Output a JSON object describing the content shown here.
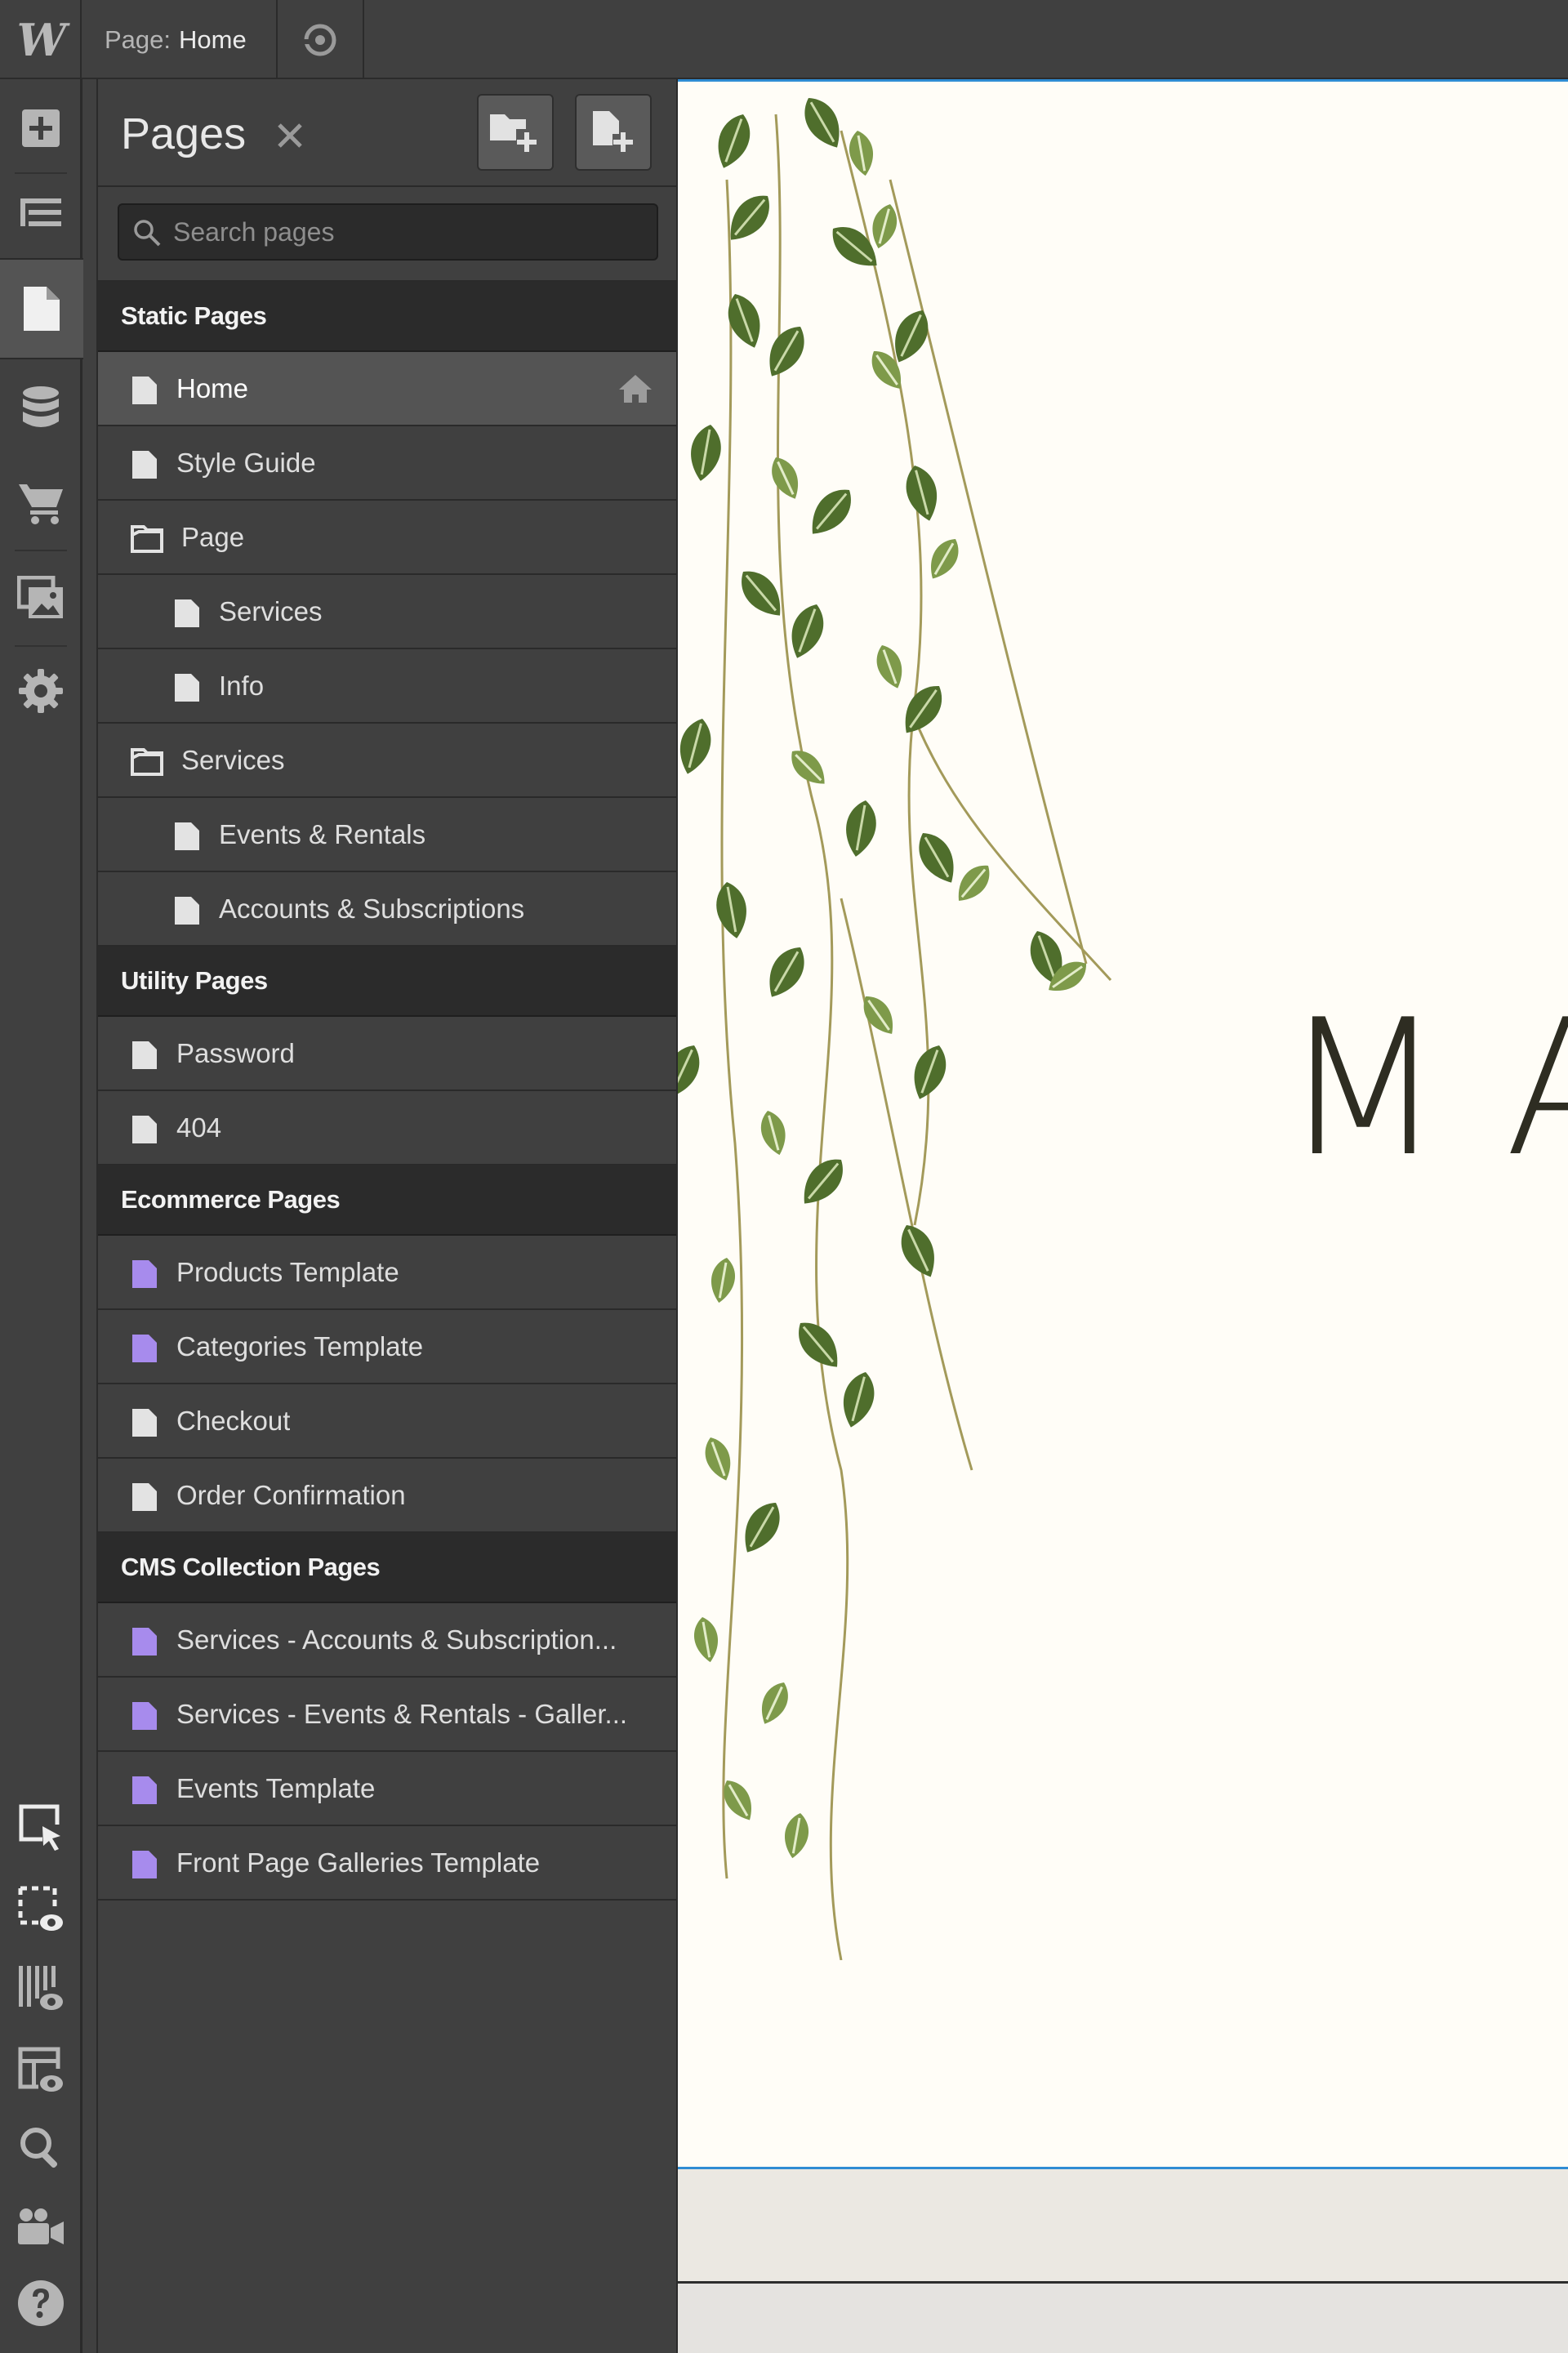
{
  "app": {
    "logo": "W"
  },
  "topbar": {
    "page_label": "Page:",
    "page_name": "Home"
  },
  "rail": {
    "items": [
      "add-icon",
      "navigator-icon",
      "pages-icon",
      "cms-icon",
      "ecommerce-icon",
      "assets-icon",
      "settings-icon"
    ],
    "bottom_items": [
      "select-element-icon",
      "show-outlines-icon",
      "grid-overlay-icon",
      "layout-preview-icon",
      "search-icon",
      "video-tutorials-icon",
      "help-icon"
    ],
    "active": "pages-icon"
  },
  "panel": {
    "title": "Pages",
    "search_placeholder": "Search pages",
    "sections": [
      {
        "title": "Static Pages",
        "rows": [
          {
            "label": "Home",
            "icon": "page",
            "level": 0,
            "selected": true,
            "home": true
          },
          {
            "label": "Style Guide",
            "icon": "page",
            "level": 0
          },
          {
            "label": "Page",
            "icon": "folder",
            "level": 0
          },
          {
            "label": "Services",
            "icon": "page",
            "level": 1
          },
          {
            "label": "Info",
            "icon": "page",
            "level": 1
          },
          {
            "label": "Services",
            "icon": "folder",
            "level": 0
          },
          {
            "label": "Events & Rentals",
            "icon": "page",
            "level": 1
          },
          {
            "label": "Accounts & Subscriptions",
            "icon": "page",
            "level": 1
          }
        ]
      },
      {
        "title": "Utility Pages",
        "rows": [
          {
            "label": "Password",
            "icon": "page",
            "level": 0
          },
          {
            "label": "404",
            "icon": "page",
            "level": 0
          }
        ]
      },
      {
        "title": "Ecommerce Pages",
        "rows": [
          {
            "label": "Products Template",
            "icon": "template",
            "level": 0
          },
          {
            "label": "Categories Template",
            "icon": "template",
            "level": 0
          },
          {
            "label": "Checkout",
            "icon": "page",
            "level": 0
          },
          {
            "label": "Order Confirmation",
            "icon": "page",
            "level": 0
          }
        ]
      },
      {
        "title": "CMS Collection Pages",
        "rows": [
          {
            "label": "Services - Accounts & Subscription...",
            "icon": "template",
            "level": 0
          },
          {
            "label": "Services - Events & Rentals - Galler...",
            "icon": "template",
            "level": 0
          },
          {
            "label": "Events Template",
            "icon": "template",
            "level": 0
          },
          {
            "label": "Front Page Galleries Template",
            "icon": "template",
            "level": 0
          }
        ]
      }
    ]
  },
  "canvas": {
    "hero_text": "MA"
  },
  "colors": {
    "template_icon": "#a78bed",
    "page_icon": "#e3e3e3",
    "selection_border": "#2f8cd3"
  }
}
